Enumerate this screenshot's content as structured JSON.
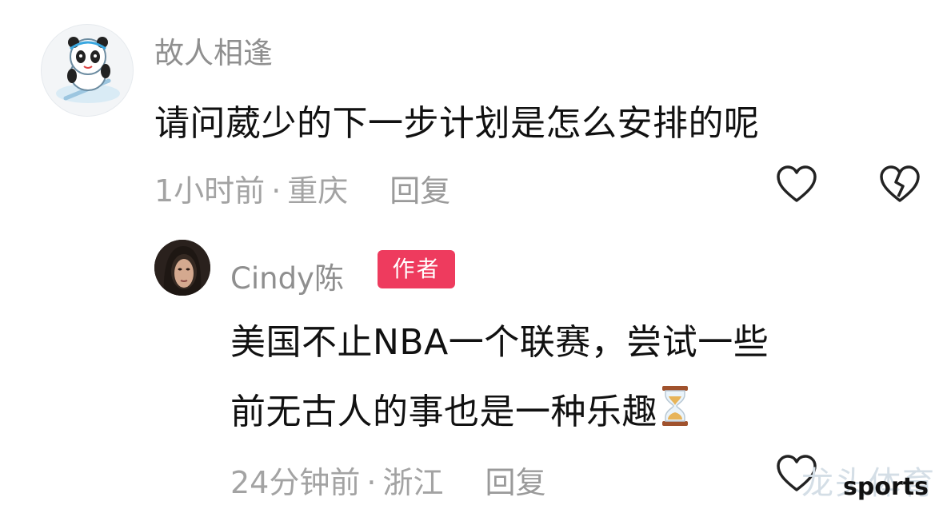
{
  "comments": [
    {
      "username": "故人相逢",
      "text": "请问葳少的下一步计划是怎么安排的呢",
      "time": "1小时前",
      "location": "重庆",
      "reply_label": "回复"
    },
    {
      "username": "Cindy陈",
      "badge": "作者",
      "text_line1": "美国不止NBA一个联赛，尝试一些",
      "text_line2": "前无古人的事也是一种乐趣",
      "emoji": "hourglass",
      "time": "24分钟前",
      "location": "浙江",
      "reply_label": "回复"
    }
  ],
  "separator": "·",
  "watermark": {
    "cn": "龙头体育",
    "en": "sports"
  },
  "colors": {
    "badge": "#ee3b5e",
    "meta": "#a3a3a3",
    "text": "#111111"
  }
}
